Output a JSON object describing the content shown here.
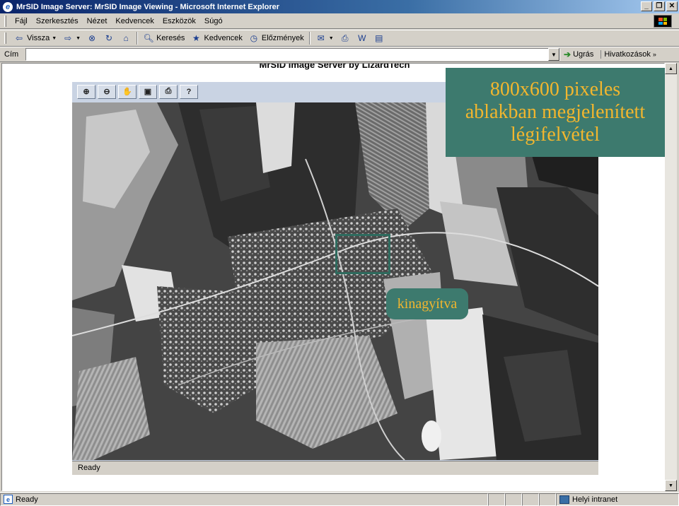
{
  "window": {
    "title": "MrSID Image Server: MrSID Image Viewing - Microsoft Internet Explorer",
    "controls": [
      "_",
      "❐",
      "✕"
    ]
  },
  "menu": [
    "Fájl",
    "Szerkesztés",
    "Nézet",
    "Kedvencek",
    "Eszközök",
    "Súgó"
  ],
  "toolbar": {
    "back_label": "Vissza",
    "search_label": "Keresés",
    "favorites_label": "Kedvencek",
    "history_label": "Előzmények"
  },
  "address": {
    "label": "Cím",
    "value": "",
    "go_label": "Ugrás",
    "links_label": "Hivatkozások"
  },
  "page": {
    "heading": "MrSID Image Server by LizardTech"
  },
  "viewer": {
    "tools": [
      "zoom-in",
      "zoom-out",
      "pan",
      "full-view",
      "print",
      "help"
    ],
    "status": "Ready"
  },
  "callouts": {
    "main_lines": [
      "800x600 pixeles",
      "ablakban megjelenített",
      "légifelvétel"
    ],
    "zoom_label": "kinagyítva"
  },
  "statusbar": {
    "status": "Ready",
    "zone": "Helyi intranet"
  },
  "colors": {
    "callout_bg": "#3d7a6e",
    "callout_text": "#f2b62e",
    "title_gradient_start": "#0a246a"
  }
}
